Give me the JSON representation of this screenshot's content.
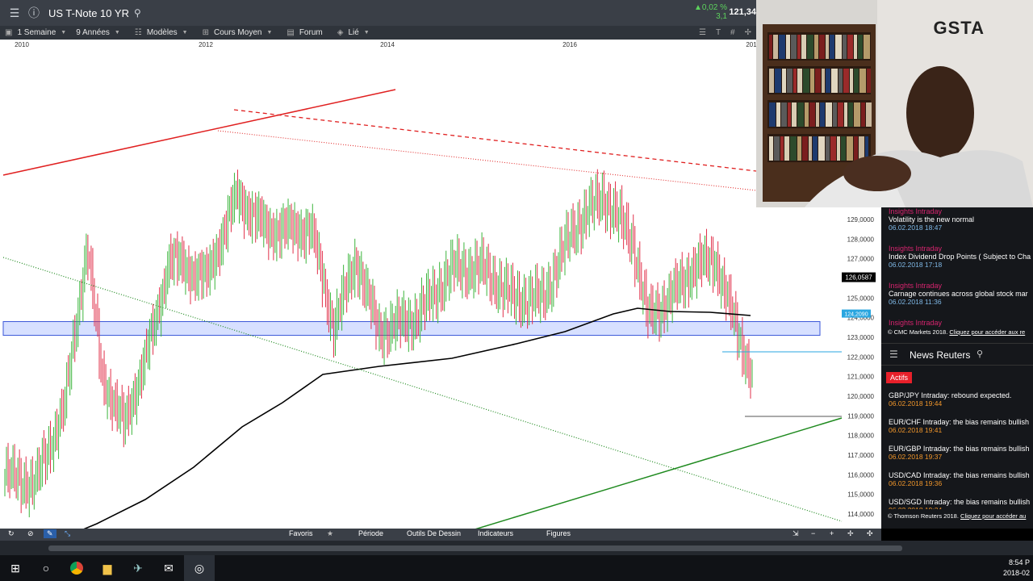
{
  "header": {
    "symbol": "US T-Note 10 YR",
    "change_pct": "▲0,02 %",
    "change_abs": "3,1",
    "last_price": "121,34"
  },
  "toolbar": {
    "interval": "1 Semaine",
    "range": "9 Années",
    "models": "Modèles",
    "average": "Cours Moyen",
    "forum": "Forum",
    "linked": "Lié"
  },
  "chart_data": {
    "type": "candlestick",
    "x_ticks": [
      "2010",
      "2012",
      "2014",
      "2016",
      "201"
    ],
    "y_ticks": [
      "129,0000",
      "128,0000",
      "127,0000",
      "126,0000",
      "125,0000",
      "124,0000",
      "123,0000",
      "122,0000",
      "121,0000",
      "120,0000",
      "119,0000",
      "118,0000",
      "117,0000",
      "116,0000",
      "115,0000",
      "114,0000"
    ],
    "ylim": [
      113.7,
      129.4
    ],
    "price_label": "126,0587",
    "level_label": "124,2090",
    "support_zone": [
      123.1,
      123.8
    ],
    "colors": {
      "up": "#3cb43c",
      "down": "#e0304a",
      "ma": "#000000",
      "zone": "#c9d6ff"
    }
  },
  "chart_toolbar": {
    "favoris": "Favoris",
    "periode": "Période",
    "outils": "Outils De Dessin",
    "indicateurs": "Indicateurs",
    "figures": "Figures"
  },
  "webcam": {
    "logo": "GSTA"
  },
  "insights": {
    "items": [
      {
        "category": "Insights Intraday",
        "title": "Volatility is the new normal",
        "date": "06.02.2018 18:47"
      },
      {
        "category": "Insights Intraday",
        "title": "Index Dividend Drop Points ( Subject to Cha",
        "date": "06.02.2018 17:18"
      },
      {
        "category": "Insights Intraday",
        "title": "Carnage continues across global stock mar",
        "date": "06.02.2018 11:36"
      },
      {
        "category": "Insights Intraday",
        "title": "",
        "date": ""
      }
    ],
    "credit_prefix": "© CMC Markets 2018.",
    "credit_link": "Cliquez pour accéder aux re"
  },
  "news": {
    "title": "News Reuters",
    "tab": "Actifs",
    "items": [
      {
        "title": "GBP/JPY Intraday: rebound expected.",
        "date": "06.02.2018 19:44"
      },
      {
        "title": "EUR/CHF Intraday: the bias remains bullish",
        "date": "06.02.2018 19:41"
      },
      {
        "title": "EUR/GBP Intraday: the bias remains bullish",
        "date": "06.02.2018 19:37"
      },
      {
        "title": "USD/CAD Intraday: the bias remains bullish",
        "date": "06.02.2018 19:36"
      },
      {
        "title": "USD/SGD Intraday: the bias remains bullish",
        "date": "06.02.2018 19:34"
      }
    ],
    "credit_prefix": "© Thomson Reuters 2018.",
    "credit_link": "Cliquez pour accéder au"
  },
  "taskbar": {
    "time": "8:54 P",
    "date": "2018-02"
  }
}
